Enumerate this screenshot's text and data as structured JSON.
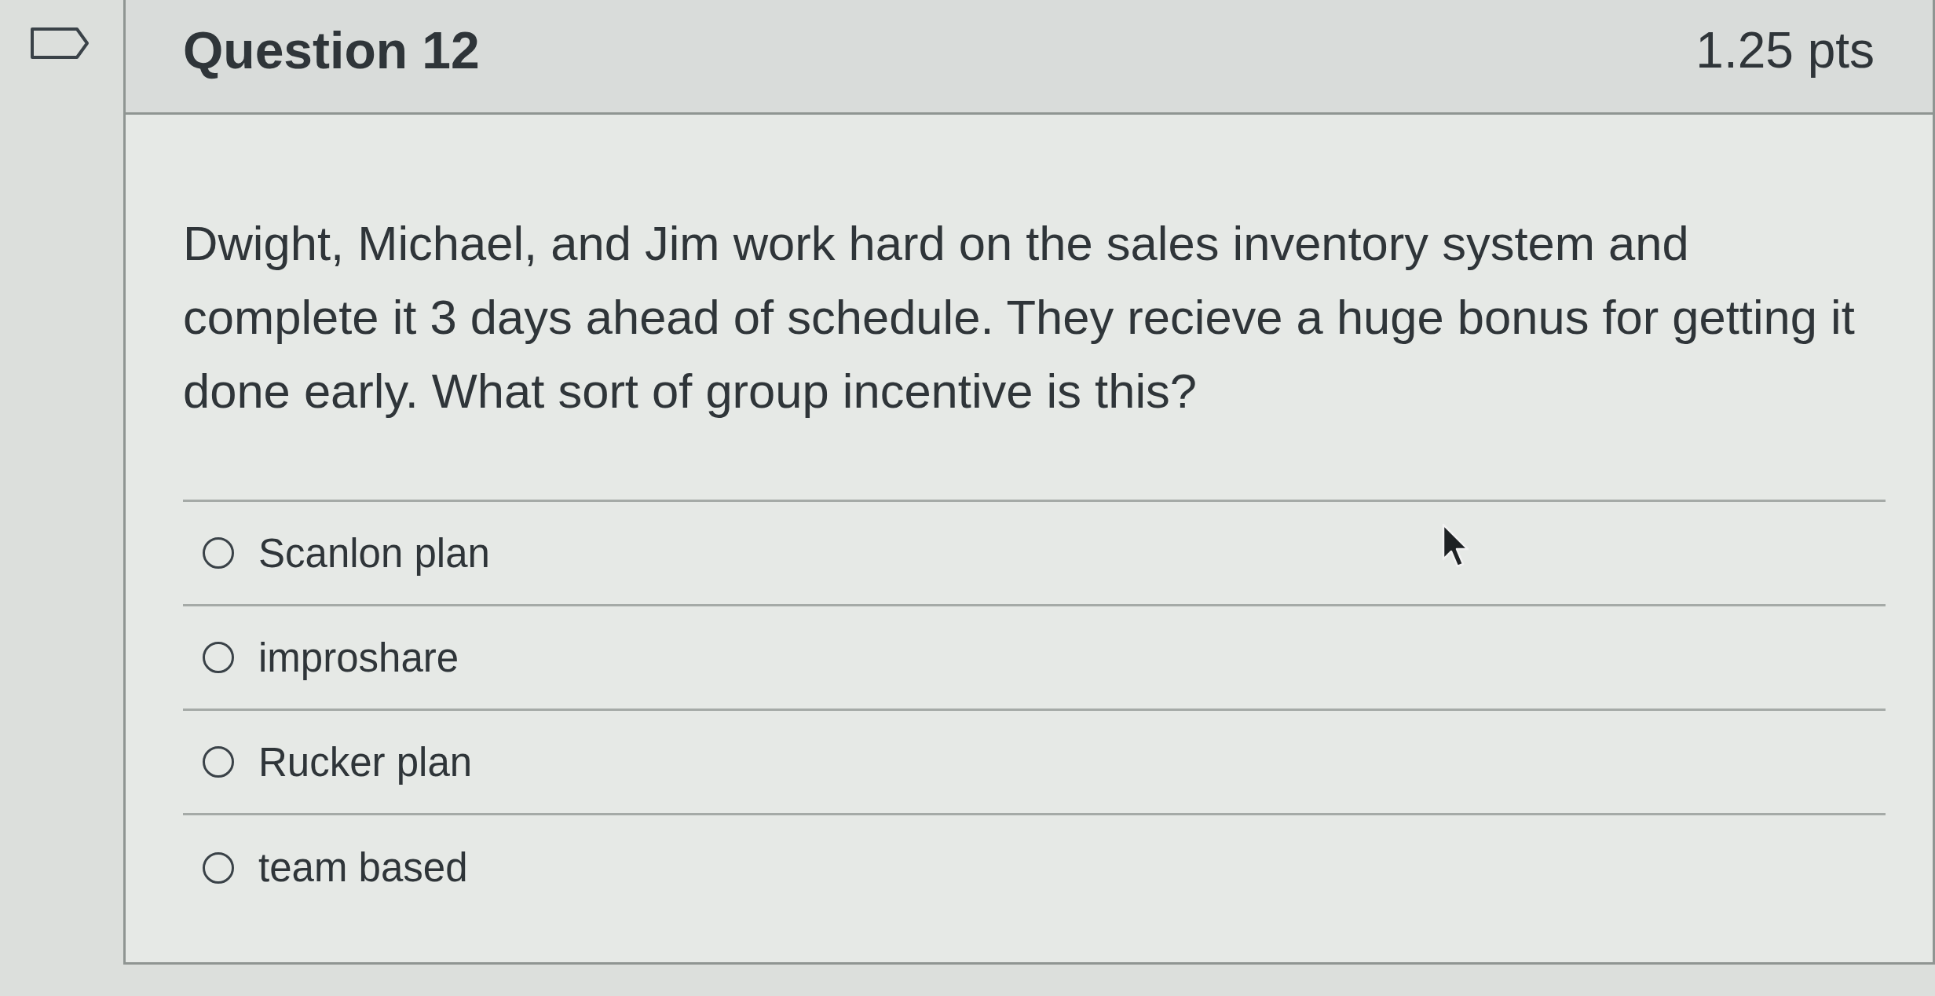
{
  "sidebar": {
    "flag": {
      "flagged": false
    }
  },
  "question": {
    "title": "Question 12",
    "points": "1.25 pts",
    "text": "Dwight, Michael, and Jim work hard on the sales inventory system and complete it 3 days ahead of schedule. They recieve a huge bonus for getting it done early. What sort of group incentive is this?",
    "options": [
      {
        "label": "Scanlon plan",
        "selected": false
      },
      {
        "label": "improshare",
        "selected": false
      },
      {
        "label": "Rucker plan",
        "selected": false
      },
      {
        "label": "team based",
        "selected": false
      }
    ]
  }
}
